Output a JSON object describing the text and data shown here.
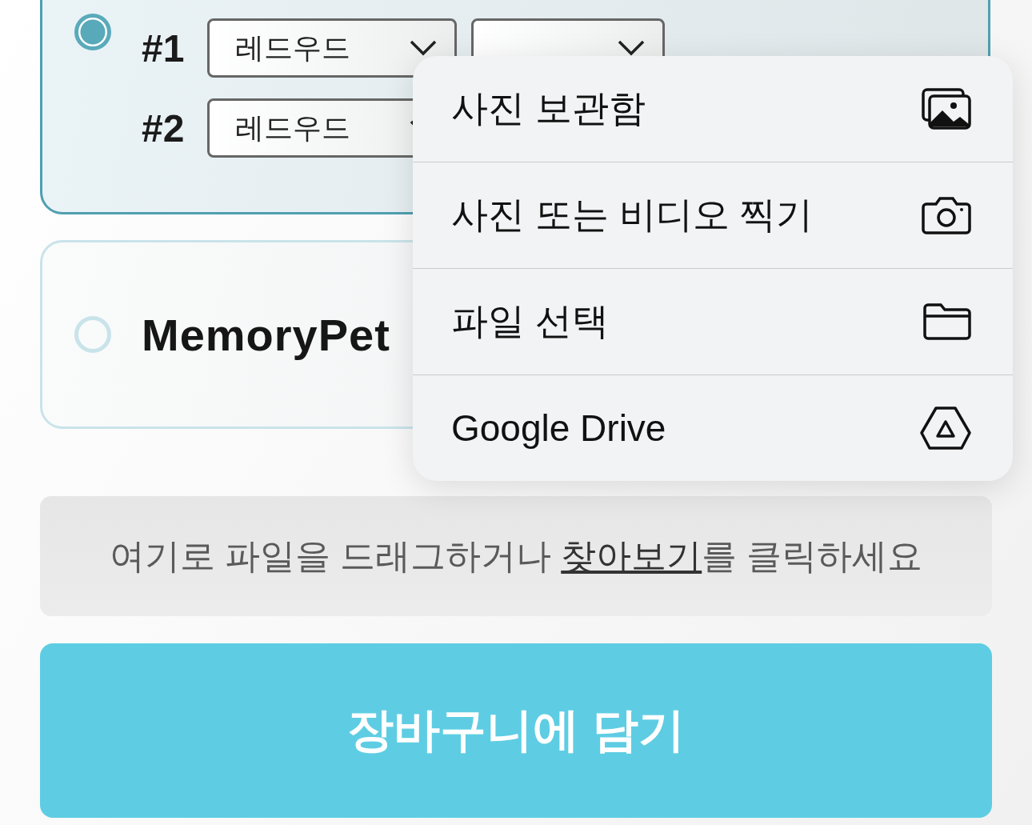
{
  "options": [
    {
      "kind": "engraving",
      "selected": true,
      "lines": [
        {
          "label": "#1",
          "selects": [
            "레드우드"
          ],
          "covered_select": true
        },
        {
          "label": "#2",
          "selects": [
            "레드우드"
          ]
        }
      ]
    },
    {
      "kind": "product",
      "selected": false,
      "title": "MemoryPet"
    }
  ],
  "popup_menu": [
    {
      "label": "사진 보관함",
      "kind": "photos"
    },
    {
      "label": "사진 또는 비디오 찍기",
      "kind": "camera"
    },
    {
      "label": "파일 선택",
      "kind": "folder"
    },
    {
      "label": "Google Drive",
      "kind": "drive"
    }
  ],
  "dropzone": {
    "before": "여기로 파일을 드래그하거나 ",
    "link": "찾아보기",
    "after": "를 클릭하세요"
  },
  "submit_button": "장바구니에 담기"
}
